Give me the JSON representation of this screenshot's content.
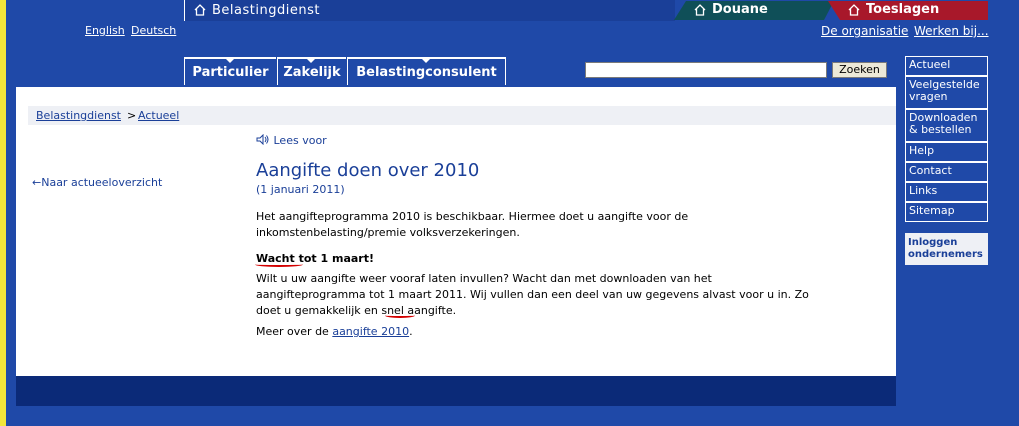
{
  "header": {
    "languages": [
      "English",
      "Deutsch"
    ],
    "brand": "Belastingdienst",
    "tabs": [
      "Douane",
      "Toeslagen"
    ],
    "top_links": [
      "De organisatie",
      "Werken bij..."
    ]
  },
  "nav": {
    "items": [
      "Particulier",
      "Zakelijk",
      "Belastingconsulent"
    ],
    "search_button": "Zoeken",
    "search_value": ""
  },
  "breadcrumb": {
    "root": "Belastingdienst",
    "separator": ">",
    "current": "Actueel"
  },
  "back_link": "Naar actueeloverzicht",
  "article": {
    "lees_voor": "Lees voor",
    "title": "Aangifte doen over 2010",
    "date": "(1 januari 2011)",
    "intro_1": "Het aangifteprogramma 2010 is beschikbaar. Hiermee doet u aangifte voor de",
    "intro_2": "inkomstenbelasting/premie volksverzekeringen.",
    "heading": "Wacht tot 1 maart!",
    "body_1": "Wilt u uw aangifte weer vooraf laten invullen? Wacht dan met downloaden van het",
    "body_2": "aangifteprogramma tot 1 maart 2011. Wij vullen dan een deel van uw gegevens alvast voor u in. Zo",
    "body_3": "doet u gemakkelijk en snel aangifte.",
    "more_prefix": "Meer over de",
    "more_link": "aangifte 2010",
    "more_suffix": "."
  },
  "sidebar": {
    "items": [
      "Actueel",
      "Veelgestelde vragen",
      "Downloaden & bestellen",
      "Help",
      "Contact",
      "Links",
      "Sitemap"
    ],
    "login": "Inloggen ondernemers"
  }
}
